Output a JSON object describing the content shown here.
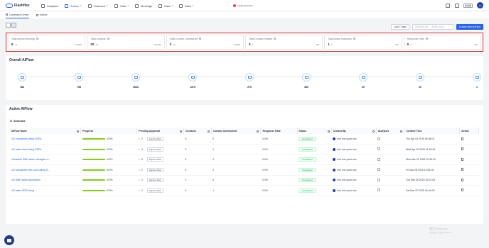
{
  "app": {
    "name": "Flashflex"
  },
  "nav": [
    {
      "label": "Analytics",
      "icon": "analytics-icon",
      "dropdown": false
    },
    {
      "label": "Airflow",
      "icon": "airflow-icon",
      "dropdown": true,
      "active": true
    },
    {
      "label": "Outreach",
      "icon": "outreach-icon",
      "dropdown": true
    },
    {
      "label": "Calls",
      "icon": "phone-icon",
      "dropdown": true
    },
    {
      "label": "Meetings",
      "icon": "calendar-icon",
      "dropdown": false
    },
    {
      "label": "Data",
      "icon": "data-icon",
      "dropdown": true
    },
    {
      "label": "Data",
      "icon": "database-icon",
      "dropdown": true
    }
  ],
  "extension_label": "Install Extension",
  "user": {
    "initials": "JO",
    "badge": "新功能"
  },
  "tabs": [
    {
      "label": "Command Center",
      "active": true
    },
    {
      "label": "Unibox",
      "active": false
    }
  ],
  "filters": {
    "range": "Last 7 days",
    "date_range": "2025-03-26 → 2025-04-02",
    "new_button": "Create New AIFlow"
  },
  "stats": [
    {
      "label": "Total Airflow Running",
      "value": "6",
      "delta": "+4",
      "pct": "↑+200%"
    },
    {
      "label": "Total contacts",
      "value": "20",
      "delta": "+9",
      "pct": "↑+81.8%"
    },
    {
      "label": "Total Contact Outreached",
      "value": "3",
      "delta": "+2",
      "pct": "↑+200%"
    },
    {
      "label": "Total Contact Replied",
      "value": "0",
      "delta": "0",
      "pct": "0%"
    },
    {
      "label": "Total Action Maildown",
      "value": "1",
      "delta": "0",
      "pct": "0%"
    },
    {
      "label": "Response Rate",
      "value": "0",
      "delta": "0",
      "pct": "0%"
    }
  ],
  "overall": {
    "title": "Overall AIFlow",
    "items": [
      "186",
      "798",
      "2633",
      "1373",
      "275",
      "360",
      "20",
      "20",
      "1"
    ]
  },
  "active": {
    "title": "Active AIFlow",
    "selected_label": "Selected",
    "columns": [
      "AIFlow Name",
      "Progress",
      "Pending Approval",
      "Contacts",
      "Contact Outreached",
      "Response Rate",
      "Status",
      "Created By",
      "Analytics",
      "Created Time",
      "Action"
    ],
    "approve_label": "Approve Now",
    "rows": [
      {
        "name": "US companies hiring SDRs",
        "progress": "100%",
        "pending": "2",
        "contacts": "5",
        "outreached": "0",
        "rate": "0.0%",
        "status": "Completed",
        "by": "zhe one yuan two",
        "time": "Thu Apr 03 2025 09:46:01"
      },
      {
        "name": "US sales team hiring SDRs",
        "progress": "100%",
        "pending": "4",
        "contacts": "5",
        "outreached": "1",
        "rate": "0.0%",
        "status": "Completed",
        "by": "zhe one yuan two",
        "time": "Wed Apr 02 2025 11:45:45"
      },
      {
        "name": "Canadian SME sales managers a...",
        "progress": "100%",
        "pending": "5",
        "contacts": "5",
        "outreached": "0",
        "rate": "0.0%",
        "status": "Completed",
        "by": "zhe one yuan two",
        "time": "Mon Mar 31 2025 10:39:02"
      },
      {
        "name": "US companies hire cold calling S...",
        "progress": "100%",
        "pending": "2",
        "contacts": "5",
        "outreached": "2",
        "rate": "0.0%",
        "status": "Completed",
        "by": "zhe one yuan two",
        "time": "Fri Mar 28 2025 11:08:18"
      },
      {
        "name": "US SME sales automation",
        "progress": "100%",
        "pending": "2",
        "contacts": "0",
        "outreached": "0",
        "rate": "0.0%",
        "status": "Completed",
        "by": "zhe one yuan two",
        "time": "Tue Mar 25 2025 15:22:53"
      },
      {
        "name": "US sales SDR hiring",
        "progress": "100%",
        "pending": "2",
        "contacts": "5",
        "outreached": "1",
        "rate": "0.0%",
        "status": "Completed",
        "by": "zhe one yuan two",
        "time": "Sat Mar 22 2025 16:44:09"
      }
    ]
  },
  "watermark": {
    "line1": "激活 Windows",
    "line2": "转到\"设置\"以激活 Windows。"
  }
}
